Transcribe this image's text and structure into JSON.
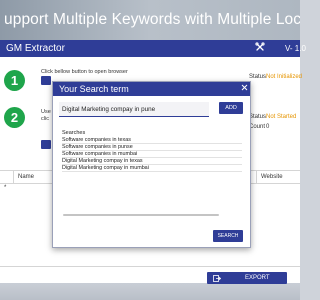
{
  "banner": {
    "title": "upport Multiple Keywords with Multiple Locations"
  },
  "window": {
    "title": "GM Extractor",
    "tools_icon": "tools-icon",
    "version": "V- 1.0"
  },
  "steps": [
    {
      "number": "1",
      "instruction": "Click bellow button to open browser",
      "status_label": "Status",
      "status_value": "Not Initialized"
    },
    {
      "number": "2",
      "instruction_lines": [
        "Use",
        "clic"
      ],
      "status_label": "Status",
      "status_value": "Not Started",
      "count_label": "Count",
      "count_value": "0"
    }
  ],
  "table": {
    "columns": [
      "Name",
      "Website"
    ],
    "row_marker": "*"
  },
  "export": {
    "label": "EXPORT",
    "icon": "export-icon"
  },
  "dialog": {
    "title": "Your Search term",
    "close_icon": "close-icon",
    "input_value": "Digital Marketing compay in pune",
    "add_label": "ADD",
    "searches_label": "Searches",
    "searches": [
      "Software companies in texas",
      "Software companies in punse",
      "Software companies in mumbai",
      "Digital Marketing compay in texas",
      "Digital Marketing compay in mumbai"
    ],
    "search_label": "SEARCH"
  },
  "colors": {
    "primary": "#2f3d97",
    "step_green": "#1fa54b",
    "status_orange": "#e69500"
  }
}
